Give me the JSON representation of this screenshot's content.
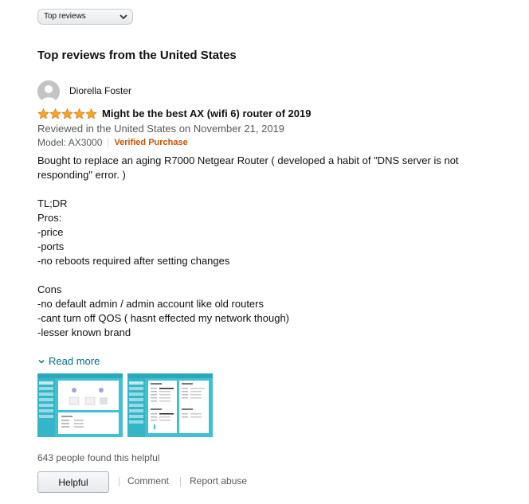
{
  "sort": {
    "selected": "Top reviews",
    "icon": "chevron-down-icon"
  },
  "section": {
    "title": "Top reviews from the United States"
  },
  "review": {
    "reviewer": "Diorella Foster",
    "avatar_icon": "user-avatar-icon",
    "rating": 5,
    "rating_color": "#f5a623",
    "title": "Might be the best AX (wifi 6) router of 2019",
    "date": "Reviewed in the United States on November 21, 2019",
    "model": "Model: AX3000",
    "verified": "Verified Purchase",
    "verified_color": "#c45500",
    "body": {
      "intro": "Bought to replace an aging R7000 Netgear Router ( developed a habit of \"DNS server is not responding\" error. )",
      "tldr": "TL;DR",
      "pros_header": "Pros:",
      "pros": [
        "-price",
        "-ports",
        "-no reboots required after setting changes"
      ],
      "cons_header": "Cons",
      "cons": [
        "-no default admin / admin account like old routers",
        "-cant turn off QOS ( hasnt effected my network though)",
        "-lesser known brand"
      ]
    },
    "read_more": "Read more",
    "read_more_color": "#007185",
    "images": [
      "router-admin-screenshot-1",
      "router-admin-screenshot-2"
    ],
    "helpful_count": "643 people found this helpful",
    "helpful_button": "Helpful",
    "comment_link": "Comment",
    "report_link": "Report abuse"
  }
}
